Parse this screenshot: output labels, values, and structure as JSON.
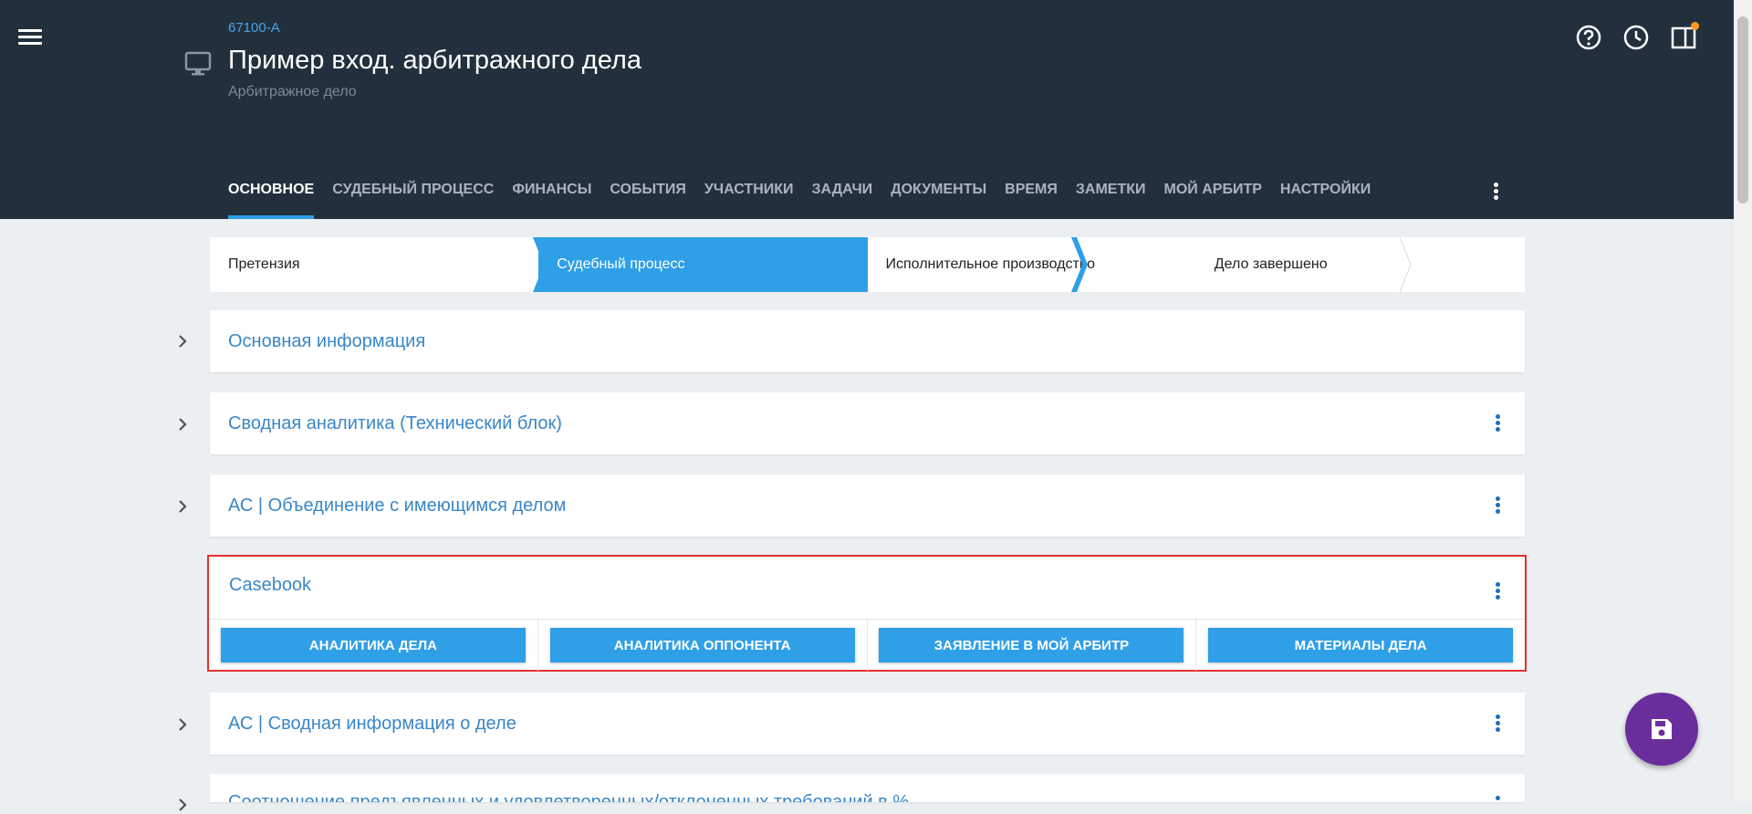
{
  "header": {
    "case_id": "67100-А",
    "title": "Пример вход. арбитражного дела",
    "subtitle": "Арбитражное дело",
    "notification_dot_color": "#ff9a1f"
  },
  "tabs": [
    {
      "label": "ОСНОВНОЕ",
      "active": true
    },
    {
      "label": "СУДЕБНЫЙ ПРОЦЕСС"
    },
    {
      "label": "ФИНАНСЫ"
    },
    {
      "label": "СОБЫТИЯ"
    },
    {
      "label": "УЧАСТНИКИ"
    },
    {
      "label": "ЗАДАЧИ"
    },
    {
      "label": "ДОКУМЕНТЫ"
    },
    {
      "label": "ВРЕМЯ"
    },
    {
      "label": "ЗАМЕТКИ"
    },
    {
      "label": "МОЙ АРБИТР"
    },
    {
      "label": "НАСТРОЙКИ"
    }
  ],
  "steps": [
    {
      "label": "Претензия"
    },
    {
      "label": "Судебный процесс",
      "active": true
    },
    {
      "label": "Исполнительное производство"
    },
    {
      "label": "Дело завершено"
    }
  ],
  "sections": {
    "basic_info": "Основная информация",
    "summary_analytics": "Сводная аналитика (Технический блок)",
    "merge": "АС | Объединение с имеющимся делом",
    "casebook": "Casebook",
    "case_summary": "АС | Сводная информация о деле",
    "partial": "Соотношение предъявленных и удовлетворенных/отклоненных требований в %"
  },
  "casebook_buttons": [
    "АНАЛИТИКА ДЕЛА",
    "АНАЛИТИКА ОППОНЕНТА",
    "ЗАЯВЛЕНИЕ В МОЙ АРБИТР",
    "МАТЕРИАЛЫ ДЕЛА"
  ],
  "colors": {
    "header_bg": "#22303d",
    "accent": "#2f9fe8",
    "link": "#3a86c8",
    "fab": "#6a2e9c",
    "highlight_border": "#e5302f"
  }
}
